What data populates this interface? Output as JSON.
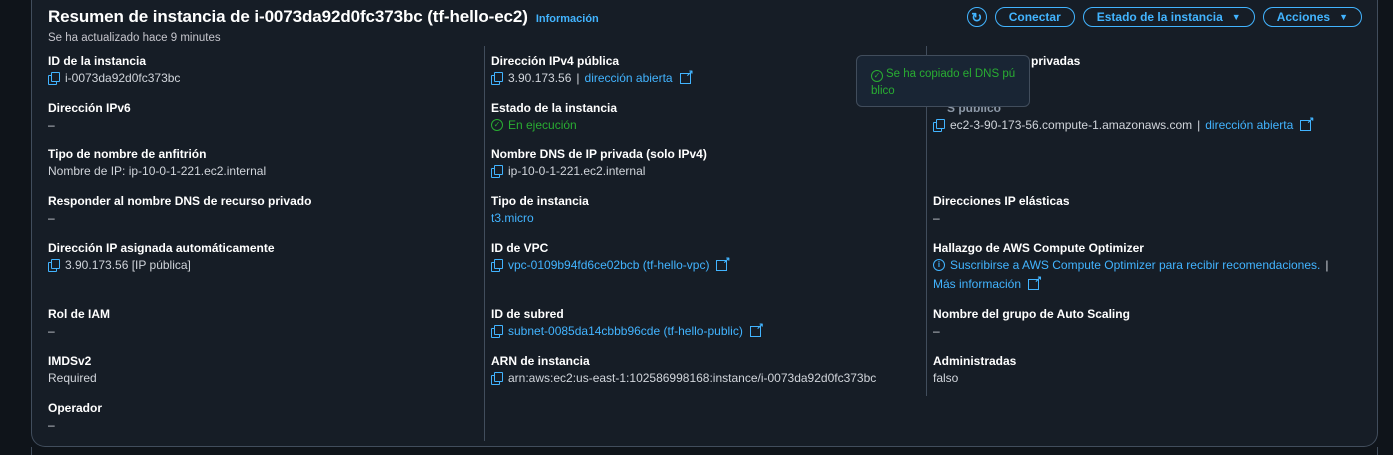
{
  "header": {
    "title": "Resumen de instancia de i-0073da92d0fc373bc (tf-hello-ec2)",
    "info_link": "Información",
    "updated": "Se ha actualizado hace 9 minutes",
    "buttons": {
      "connect": "Conectar",
      "instance_state": "Estado de la instancia",
      "actions": "Acciones"
    }
  },
  "col1": {
    "instance_id": {
      "label": "ID de la instancia",
      "value": "i-0073da92d0fc373bc"
    },
    "ipv6": {
      "label": "Dirección IPv6",
      "value": "–"
    },
    "hostname_type": {
      "label": "Tipo de nombre de anfitrión",
      "value": "Nombre de IP: ip-10-0-1-221.ec2.internal"
    },
    "resource_dns": {
      "label": "Responder al nombre DNS de recurso privado",
      "value": "–"
    },
    "auto_ip": {
      "label": "Dirección IP asignada automáticamente",
      "value": "3.90.173.56 [IP pública]"
    },
    "iam_role": {
      "label": "Rol de IAM",
      "value": "–"
    },
    "imdsv2": {
      "label": "IMDSv2",
      "value": "Required"
    },
    "operator": {
      "label": "Operador",
      "value": "–"
    }
  },
  "col2": {
    "public_ipv4": {
      "label": "Dirección IPv4 pública",
      "value": "3.90.173.56",
      "sep": "|",
      "link": "dirección abierta"
    },
    "state": {
      "label": "Estado de la instancia",
      "value": "En ejecución"
    },
    "private_dns": {
      "label": "Nombre DNS de IP privada (solo IPv4)",
      "value": "ip-10-0-1-221.ec2.internal"
    },
    "instance_type": {
      "label": "Tipo de instancia",
      "value": "t3.micro"
    },
    "vpc": {
      "label": "ID de VPC",
      "value": "vpc-0109b94fd6ce02bcb (tf-hello-vpc)"
    },
    "subnet": {
      "label": "ID de subred",
      "value": "subnet-0085da14cbbb96cde (tf-hello-public)"
    },
    "arn": {
      "label": "ARN de instancia",
      "value": "arn:aws:ec2:us-east-1:102586998168:instance/i-0073da92d0fc373bc"
    }
  },
  "col3": {
    "private_ips": {
      "label_partial": "privadas"
    },
    "public_dns": {
      "label_partial": "S público",
      "value": "ec2-3-90-173-56.compute-1.amazonaws.com",
      "sep": "|",
      "link": "dirección abierta"
    },
    "elastic_ip": {
      "label": "Direcciones IP elásticas",
      "value": "–"
    },
    "optimizer": {
      "label": "Hallazgo de AWS Compute Optimizer",
      "value": "Suscribirse a AWS Compute Optimizer para recibir recomendaciones.",
      "sep": "|",
      "more": "Más información"
    },
    "asg": {
      "label": "Nombre del grupo de Auto Scaling",
      "value": "–"
    },
    "managed": {
      "label": "Administradas",
      "value": "falso"
    }
  },
  "tooltip": {
    "line1": "Se ha copiado el DNS pú",
    "line2": "blico"
  },
  "colors": {
    "accent": "#42b4ff",
    "success": "#29ad32",
    "background": "#0f141a",
    "panel": "#161d26",
    "border": "#414d5c"
  }
}
